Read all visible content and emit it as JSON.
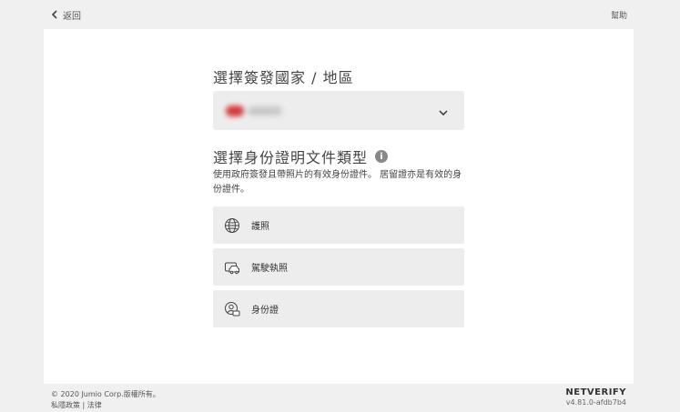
{
  "topbar": {
    "back_label": "返回",
    "help_label": "幫助"
  },
  "country": {
    "heading": "選擇簽發國家 / 地區",
    "selected_value": ""
  },
  "document": {
    "heading": "選擇身份證明文件類型",
    "info_symbol": "i",
    "description": "使用政府簽發且帶照片的有效身份證件。 居留證亦是有效的身份證件。",
    "options": [
      {
        "label": "護照",
        "icon": "globe-icon"
      },
      {
        "label": "駕駛執照",
        "icon": "car-icon"
      },
      {
        "label": "身份證",
        "icon": "id-card-icon"
      }
    ]
  },
  "footer": {
    "copyright": "© 2020 Jumio Corp.版權所有。",
    "privacy_link": "私隱政策",
    "separator": "|",
    "legal_link": "法律",
    "brand": "NETVERIFY",
    "version": "v4.81.0-afdb7b4"
  },
  "colors": {
    "background": "#f0f0f0",
    "panel": "#ffffff",
    "option_bg": "#ededed",
    "flag_red": "#d23a3a"
  }
}
